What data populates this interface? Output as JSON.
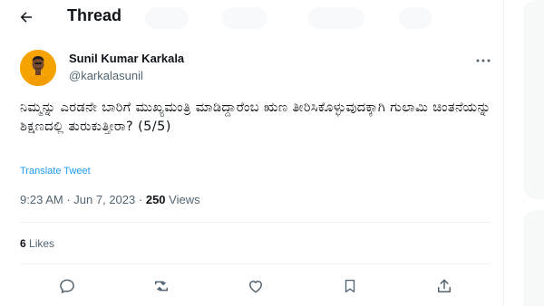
{
  "header": {
    "title": "Thread",
    "back_icon": "arrow-left-icon"
  },
  "tweet": {
    "author_name": "Sunil Kumar Karkala",
    "author_handle": "@karkalasunil",
    "text": "ನಿಮ್ಮನ್ನು ಎರಡನೇ ಬಾರಿಗೆ ಮುಖ್ಯಮಂತ್ರಿ ಮಾಡಿದ್ದಾರೆಂಬ ಋಣ ತೀರಿಸಿಕೊಳ್ಳುವುದಕ್ಕಾಗಿ ಗುಲಾಮಿ ಚಿಂತನೆಯನ್ನು ಶಿಕ್ಷಣದಲ್ಲಿ ತುರುಕುತ್ತೀರಾ? (5/5)",
    "translate_label": "Translate Tweet",
    "time": "9:23 AM",
    "separator": "·",
    "date": "Jun 7, 2023",
    "views_count": "250",
    "views_label": "Views",
    "likes_count": "6",
    "likes_label": "Likes"
  },
  "actions": [
    "reply-icon",
    "retweet-icon",
    "like-icon",
    "bookmark-icon",
    "share-icon"
  ],
  "colors": {
    "accent": "#1d9bf0",
    "text_primary": "#0f1419",
    "text_secondary": "#536471",
    "border": "#eff3f4",
    "avatar_bg": "#f5a300"
  }
}
